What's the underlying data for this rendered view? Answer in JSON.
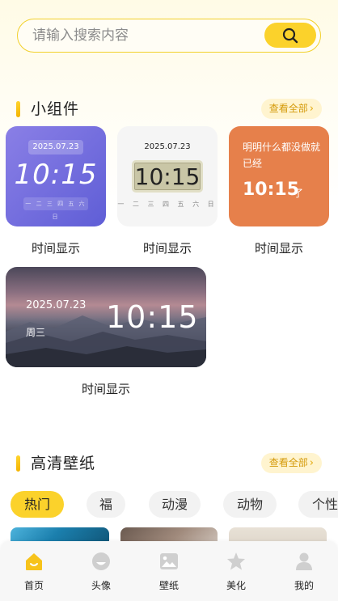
{
  "search": {
    "placeholder": "请输入搜索内容"
  },
  "widgets_section": {
    "title": "小组件",
    "view_all": "查看全部"
  },
  "widgets": [
    {
      "label": "时间显示",
      "date": "2025.07.23",
      "time": "10:15",
      "days": "一 二 三 四 五 六 日"
    },
    {
      "label": "时间显示",
      "date": "2025.07.23",
      "time": "10:15",
      "days": "一 二 三 四 五 六 日"
    },
    {
      "label": "时间显示",
      "text": "明明什么都没做就已经",
      "time": "10:15",
      "suffix": "了"
    },
    {
      "label": "时间显示",
      "date": "2025.07.23",
      "weekday": "周三",
      "time": "10:15"
    }
  ],
  "wallpaper_section": {
    "title": "高清壁纸",
    "view_all": "查看全部"
  },
  "categories": [
    "热门",
    "福",
    "动漫",
    "动物",
    "个性"
  ],
  "selected_category": "热门",
  "bottom_nav": [
    {
      "label": "首页",
      "icon": "home-icon",
      "active": true
    },
    {
      "label": "头像",
      "icon": "avatar-icon"
    },
    {
      "label": "壁纸",
      "icon": "wallpaper-icon"
    },
    {
      "label": "美化",
      "icon": "star-icon"
    },
    {
      "label": "我的",
      "icon": "profile-icon"
    }
  ],
  "colors": {
    "accent": "#fbd22b",
    "active_icon": "#f7c31b",
    "inactive_icon": "#cfcfcf"
  }
}
